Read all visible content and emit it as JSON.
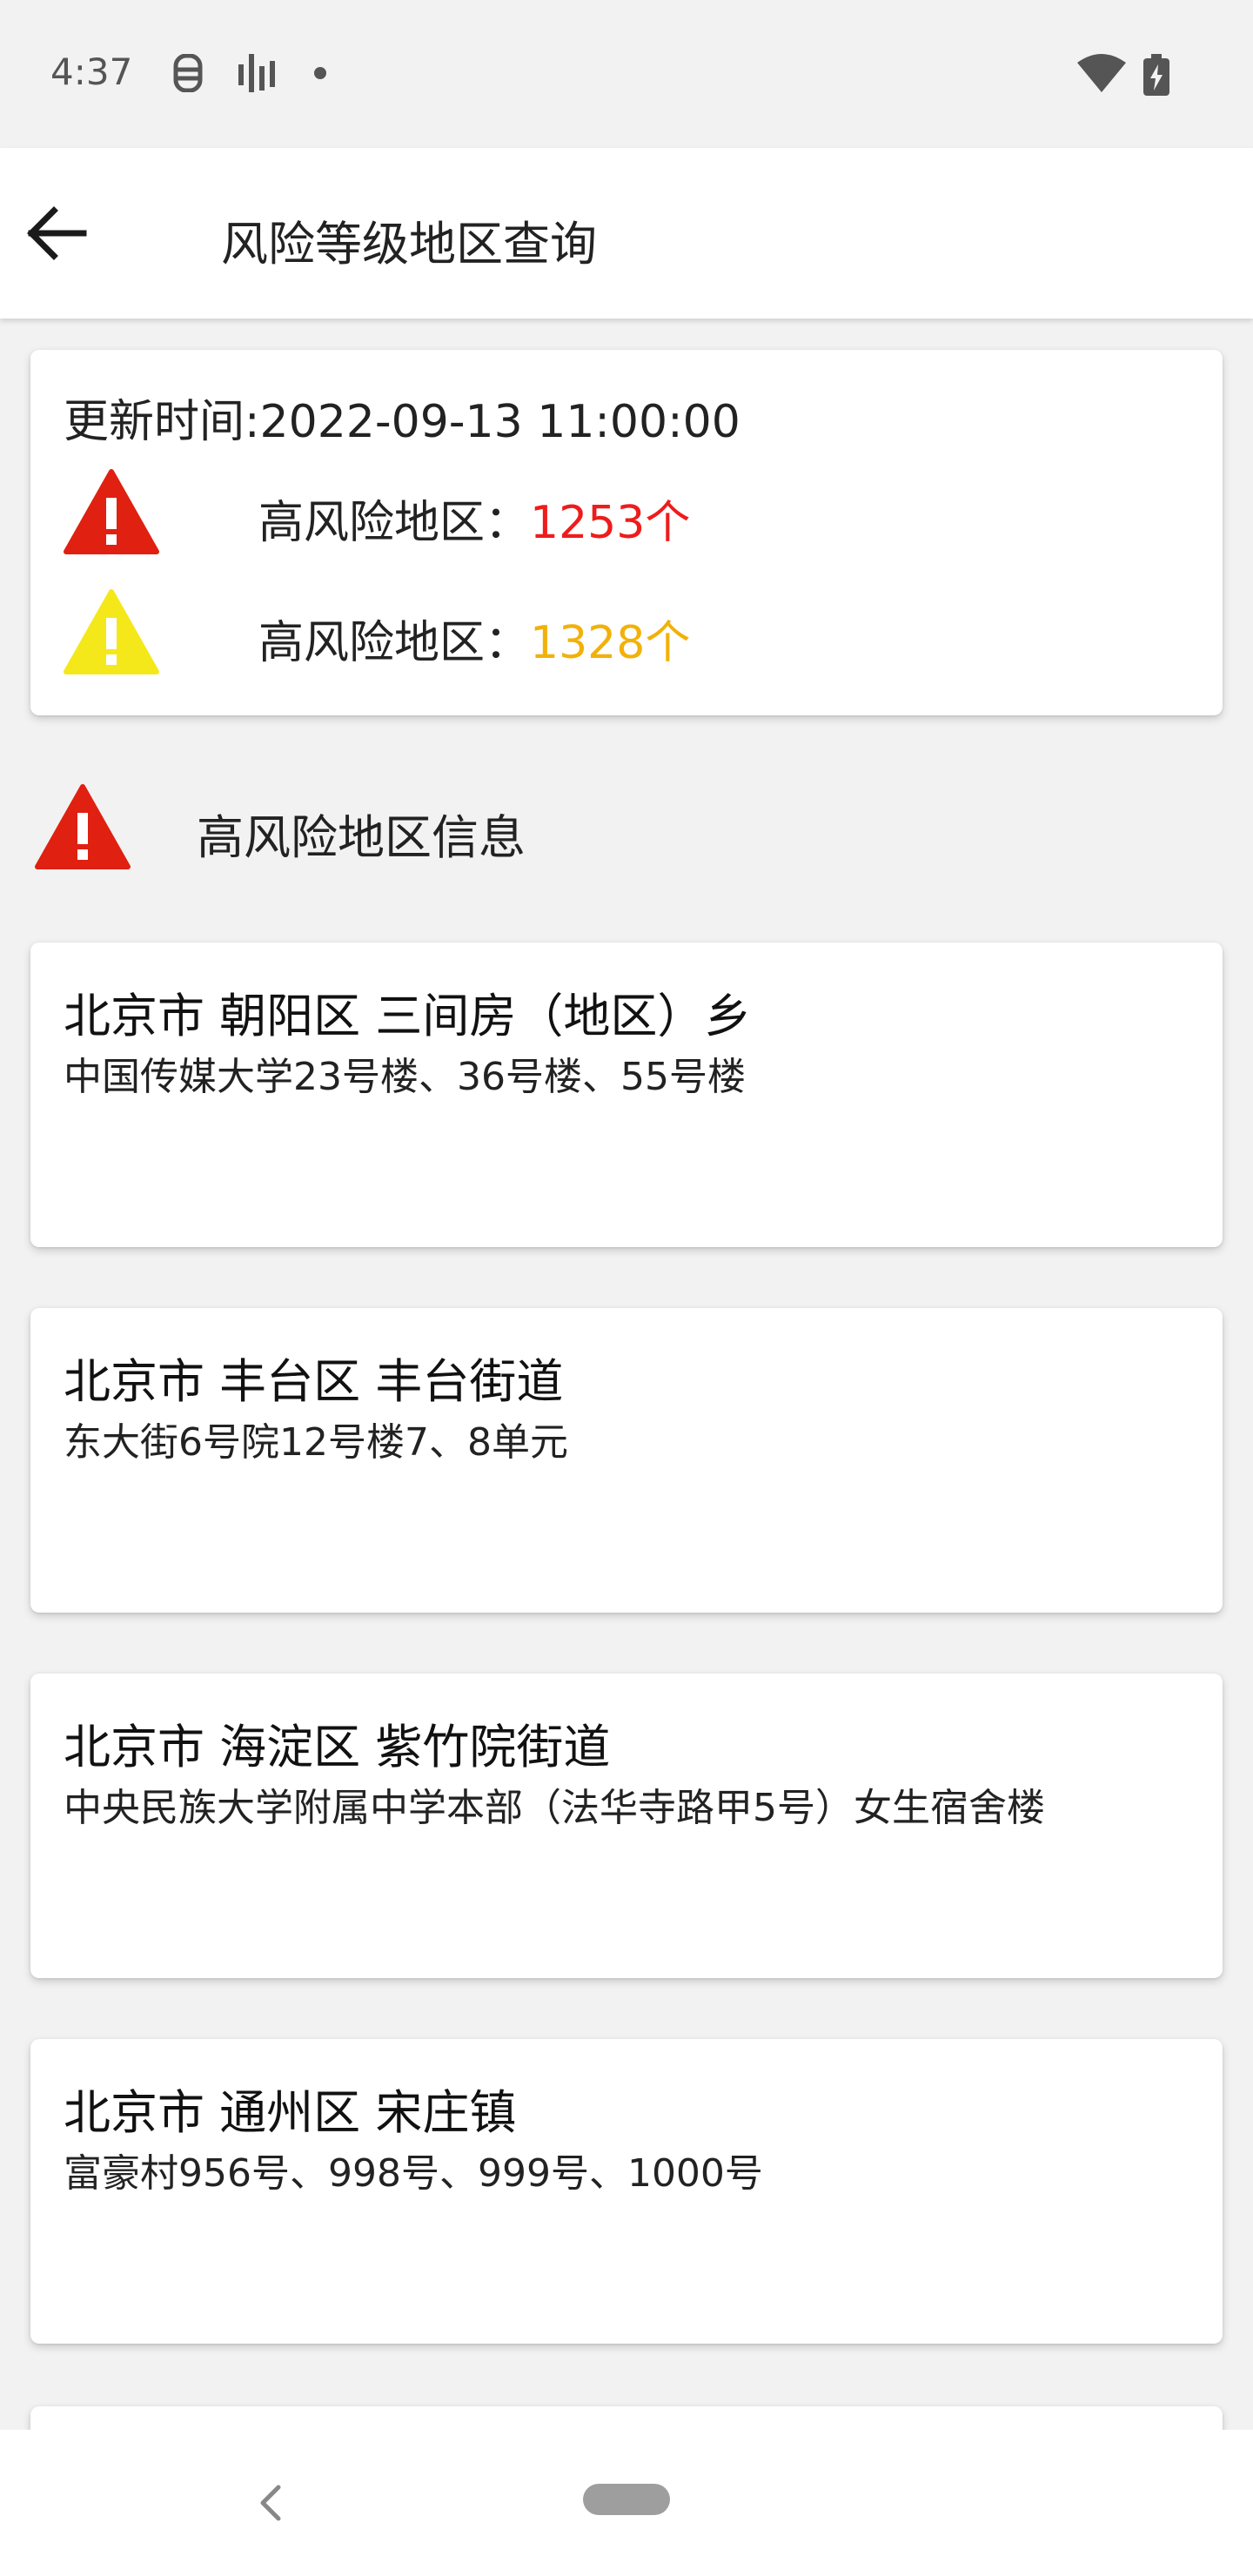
{
  "status_bar": {
    "time": "4:37",
    "icons": [
      "notification-icon",
      "signal-bars-icon",
      "dot-icon",
      "wifi-icon",
      "battery-charging-icon"
    ]
  },
  "app_bar": {
    "title": "风险等级地区查询",
    "back_icon": "arrow-left-icon"
  },
  "summary": {
    "update_time": "更新时间:2022-09-13 11:00:00",
    "rows": [
      {
        "label": "高风险地区：",
        "count": "1253个",
        "color": "#ee1c1c",
        "icon": "warning-red-icon",
        "icon_color": "#e02010"
      },
      {
        "label": "高风险地区：",
        "count": "1328个",
        "color": "#f2b10a",
        "icon": "warning-yellow-icon",
        "icon_color": "#f4e81a"
      }
    ]
  },
  "section": {
    "title": "高风险地区信息",
    "icon": "warning-red-icon",
    "icon_color": "#e02010"
  },
  "areas": [
    {
      "title": "北京市 朝阳区 三间房（地区）乡",
      "detail": "中国传媒大学23号楼、36号楼、55号楼"
    },
    {
      "title": "北京市 丰台区 丰台街道",
      "detail": "东大街6号院12号楼7、8单元"
    },
    {
      "title": "北京市 海淀区 紫竹院街道",
      "detail": "中央民族大学附属中学本部（法华寺路甲5号）女生宿舍楼"
    },
    {
      "title": "北京市 通州区 宋庄镇",
      "detail": "富豪村956号、998号、999号、1000号"
    }
  ],
  "nav_bar": {
    "back_icon": "nav-back-icon",
    "home_icon": "home-pill-icon"
  }
}
